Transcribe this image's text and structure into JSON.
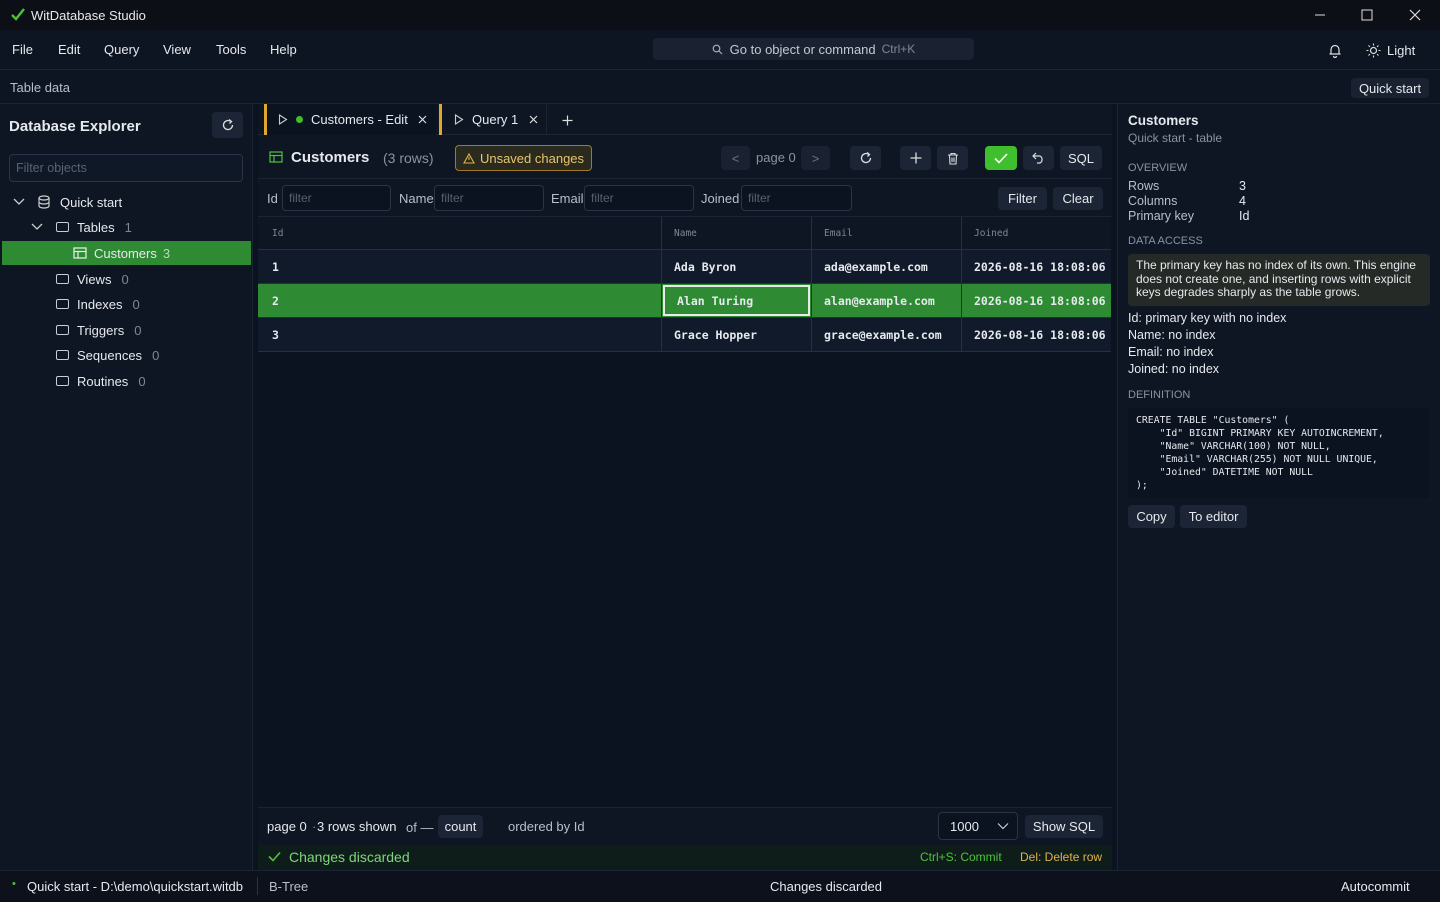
{
  "app": {
    "title": "WitDatabase Studio"
  },
  "menu": {
    "items": [
      "File",
      "Edit",
      "Query",
      "View",
      "Tools",
      "Help"
    ]
  },
  "search": {
    "placeholder": "Go to object or command",
    "shortcut": "Ctrl+K"
  },
  "theme": {
    "label": "Light"
  },
  "subbar": {
    "title": "Table data",
    "quick_start": "Quick start"
  },
  "explorer": {
    "title": "Database Explorer",
    "filter_placeholder": "Filter objects",
    "root": "Quick start",
    "tables": {
      "label": "Tables",
      "count": "1"
    },
    "customers": {
      "label": "Customers",
      "count": "3"
    },
    "folders": [
      {
        "label": "Views",
        "count": "0"
      },
      {
        "label": "Indexes",
        "count": "0"
      },
      {
        "label": "Triggers",
        "count": "0"
      },
      {
        "label": "Sequences",
        "count": "0"
      },
      {
        "label": "Routines",
        "count": "0"
      }
    ]
  },
  "tabs": [
    {
      "label": "Customers - Edit"
    },
    {
      "label": "Query 1"
    }
  ],
  "toolbar": {
    "table_name": "Customers",
    "rows": "(3 rows)",
    "unsaved": "Unsaved changes",
    "prev": "<",
    "page": "page 0",
    "next": ">",
    "sql": "SQL"
  },
  "filters": {
    "labels": [
      "Id",
      "Name",
      "Email",
      "Joined"
    ],
    "placeholder": "filter",
    "filter_btn": "Filter",
    "clear_btn": "Clear"
  },
  "grid": {
    "columns": [
      "Id",
      "Name",
      "Email",
      "Joined"
    ],
    "rows": [
      [
        "1",
        "Ada Byron",
        "ada@example.com",
        "2026-08-16 18:08:06"
      ],
      [
        "2",
        "Alan Turing",
        "alan@example.com",
        "2026-08-16 18:08:06"
      ],
      [
        "3",
        "Grace Hopper",
        "grace@example.com",
        "2026-08-16 18:08:06"
      ]
    ]
  },
  "footer": {
    "page": "page 0",
    "sep": "·",
    "shown": "3 rows shown",
    "of": "of —",
    "count": "count",
    "ordered": "ordered by Id",
    "limit": "1000",
    "show_sql": "Show SQL",
    "message": "Changes discarded",
    "hint_commit": "Ctrl+S: Commit",
    "hint_delete": "Del: Delete row"
  },
  "details": {
    "title": "Customers",
    "subtitle": "Quick start - table",
    "overview_heading": "OVERVIEW",
    "overview": [
      {
        "k": "Rows",
        "v": "3"
      },
      {
        "k": "Columns",
        "v": "4"
      },
      {
        "k": "Primary key",
        "v": "Id"
      }
    ],
    "access_heading": "DATA ACCESS",
    "warning": "The primary key has no index of its own. This engine does not create one, and inserting rows with explicit keys degrades sharply as the table grows.",
    "access_lines": [
      "Id: primary key with no index",
      "Name: no index",
      "Email: no index",
      "Joined: no index"
    ],
    "definition_heading": "DEFINITION",
    "definition": "CREATE TABLE \"Customers\" (\n    \"Id\" BIGINT PRIMARY KEY AUTOINCREMENT,\n    \"Name\" VARCHAR(100) NOT NULL,\n    \"Email\" VARCHAR(255) NOT NULL UNIQUE,\n    \"Joined\" DATETIME NOT NULL\n);",
    "copy": "Copy",
    "to_editor": "To editor"
  },
  "status": {
    "dot": "•",
    "db": "Quick start - D:\\demo\\quickstart.witdb",
    "engine": "B-Tree",
    "message": "Changes discarded",
    "mode": "Autocommit"
  },
  "colors": {
    "accent": "#2e8b34",
    "check": "#3fbf2e",
    "warning_bg": "#2a2a1e",
    "warning_border": "#a07a26"
  }
}
